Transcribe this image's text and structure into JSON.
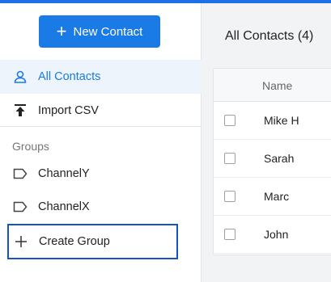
{
  "sidebar": {
    "new_contact_label": "New Contact",
    "items": [
      {
        "label": "All Contacts",
        "icon": "person-icon"
      },
      {
        "label": "Import CSV",
        "icon": "upload-icon"
      }
    ],
    "groups_heading": "Groups",
    "groups": [
      {
        "label": "ChannelY",
        "icon": "label-icon"
      },
      {
        "label": "ChannelX",
        "icon": "label-icon"
      }
    ],
    "create_group_label": "Create Group"
  },
  "main": {
    "title": "All Contacts (4)",
    "table": {
      "column_name": "Name",
      "rows": [
        "Mike H",
        "Sarah",
        "Marc",
        "John"
      ]
    }
  },
  "colors": {
    "accent": "#1a7ae6",
    "highlight_border": "#1452c8",
    "active_bg": "#eef4fb"
  }
}
